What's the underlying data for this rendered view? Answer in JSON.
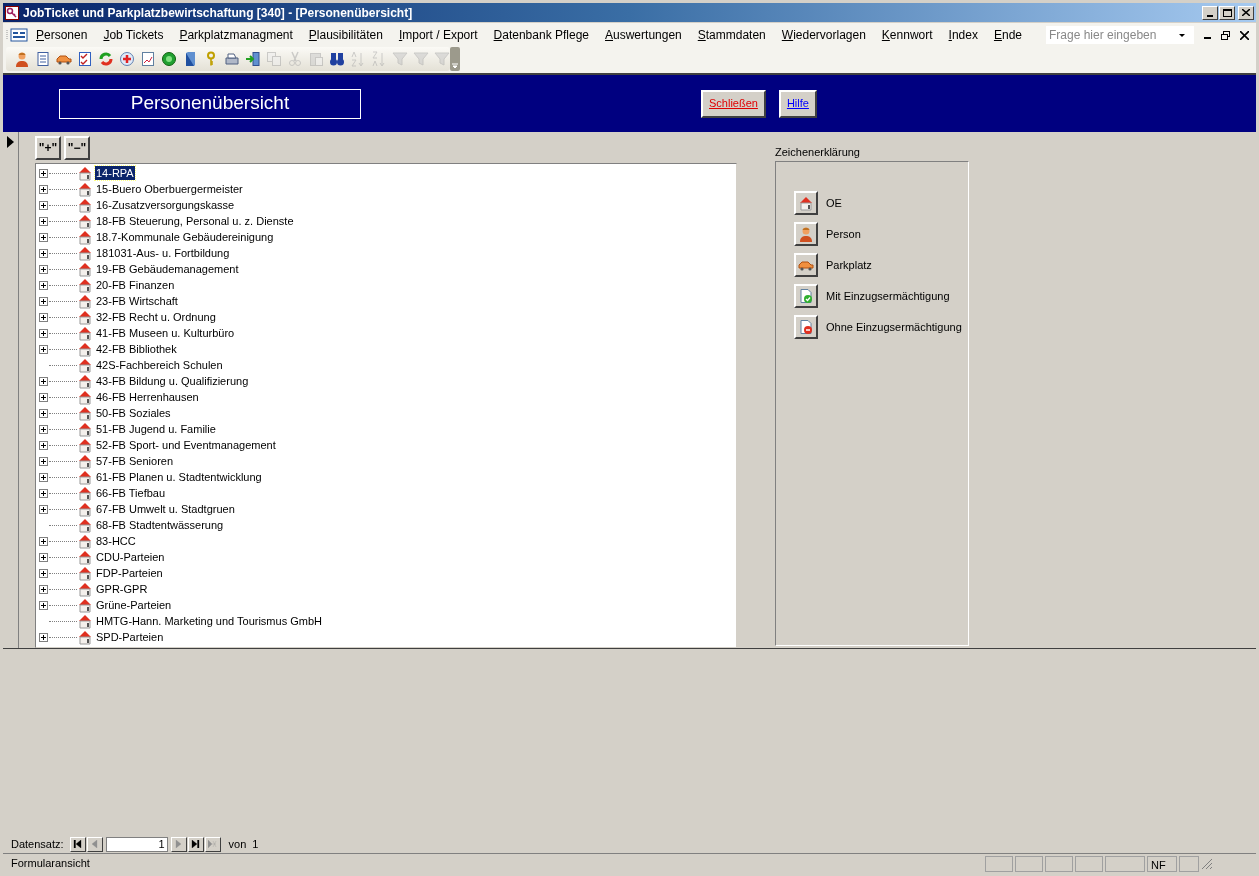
{
  "window": {
    "title": "JobTicket und Parkplatzbewirtschaftung [340] - [Personenübersicht]"
  },
  "menu": [
    "Personen",
    "Job Tickets",
    "Parkplatzmanagment",
    "Plausibilitäten",
    "Import / Export",
    "Datenbank Pflege",
    "Auswertungen",
    "Stammdaten",
    "Wiedervorlagen",
    "Kennwort",
    "Index",
    "Ende"
  ],
  "help_box": {
    "placeholder": "Frage hier eingeben"
  },
  "toolbar": [
    {
      "kind": "person",
      "disabled": false
    },
    {
      "kind": "form",
      "disabled": false
    },
    {
      "kind": "car",
      "disabled": false
    },
    {
      "kind": "checklist",
      "disabled": false
    },
    {
      "kind": "recycle",
      "disabled": false
    },
    {
      "kind": "plus",
      "disabled": false
    },
    {
      "kind": "chart",
      "disabled": false
    },
    {
      "kind": "globe",
      "disabled": false
    },
    {
      "kind": "book",
      "disabled": false
    },
    {
      "kind": "key",
      "disabled": false
    },
    {
      "kind": "printer",
      "disabled": false
    },
    {
      "kind": "exit",
      "disabled": false
    },
    {
      "kind": "copy",
      "disabled": true
    },
    {
      "kind": "cut",
      "disabled": true
    },
    {
      "kind": "paste",
      "disabled": true
    },
    {
      "kind": "binoculars",
      "disabled": false
    },
    {
      "kind": "sortasc",
      "disabled": true
    },
    {
      "kind": "sortdesc",
      "disabled": true
    },
    {
      "kind": "filter",
      "disabled": true
    },
    {
      "kind": "filter",
      "disabled": true
    },
    {
      "kind": "filter",
      "disabled": true
    }
  ],
  "form": {
    "title": "Personenübersicht",
    "buttons": [
      {
        "label": "Schließen",
        "kind": "close"
      },
      {
        "label": "Hilfe",
        "kind": "help"
      }
    ]
  },
  "tree_buttons": [
    "\"+\"",
    "\"−\""
  ],
  "tree": [
    {
      "label": "14-RPA",
      "expandable": true,
      "selected": true
    },
    {
      "label": "15-Buero Oberbuergermeister",
      "expandable": true,
      "selected": false
    },
    {
      "label": "16-Zusatzversorgungskasse",
      "expandable": true,
      "selected": false
    },
    {
      "label": "18-FB Steuerung, Personal u. z. Dienste",
      "expandable": true,
      "selected": false
    },
    {
      "label": "18.7-Kommunale Gebäudereinigung",
      "expandable": true,
      "selected": false
    },
    {
      "label": "181031-Aus- u. Fortbildung",
      "expandable": true,
      "selected": false
    },
    {
      "label": "19-FB Gebäudemanagement",
      "expandable": true,
      "selected": false
    },
    {
      "label": "20-FB Finanzen",
      "expandable": true,
      "selected": false
    },
    {
      "label": "23-FB Wirtschaft",
      "expandable": true,
      "selected": false
    },
    {
      "label": "32-FB Recht u. Ordnung",
      "expandable": true,
      "selected": false
    },
    {
      "label": "41-FB Museen u. Kulturbüro",
      "expandable": true,
      "selected": false
    },
    {
      "label": "42-FB Bibliothek",
      "expandable": true,
      "selected": false
    },
    {
      "label": "42S-Fachbereich Schulen",
      "expandable": false,
      "selected": false
    },
    {
      "label": "43-FB Bildung u. Qualifizierung",
      "expandable": true,
      "selected": false
    },
    {
      "label": "46-FB Herrenhausen",
      "expandable": true,
      "selected": false
    },
    {
      "label": "50-FB Soziales",
      "expandable": true,
      "selected": false
    },
    {
      "label": "51-FB Jugend u. Familie",
      "expandable": true,
      "selected": false
    },
    {
      "label": "52-FB Sport- und Eventmanagement",
      "expandable": true,
      "selected": false
    },
    {
      "label": "57-FB Senioren",
      "expandable": true,
      "selected": false
    },
    {
      "label": "61-FB Planen u. Stadtentwicklung",
      "expandable": true,
      "selected": false
    },
    {
      "label": "66-FB Tiefbau",
      "expandable": true,
      "selected": false
    },
    {
      "label": "67-FB Umwelt u. Stadtgruen",
      "expandable": true,
      "selected": false
    },
    {
      "label": "68-FB Stadtentwässerung",
      "expandable": false,
      "selected": false
    },
    {
      "label": "83-HCC",
      "expandable": true,
      "selected": false
    },
    {
      "label": "CDU-Parteien",
      "expandable": true,
      "selected": false
    },
    {
      "label": "FDP-Parteien",
      "expandable": true,
      "selected": false
    },
    {
      "label": "GPR-GPR",
      "expandable": true,
      "selected": false
    },
    {
      "label": "Grüne-Parteien",
      "expandable": true,
      "selected": false
    },
    {
      "label": "HMTG-Hann. Marketing und Tourismus GmbH",
      "expandable": false,
      "selected": false
    },
    {
      "label": "SPD-Parteien",
      "expandable": true,
      "selected": false
    }
  ],
  "legend": {
    "title": "Zeichenerklärung",
    "items": [
      {
        "kind": "house",
        "label": "OE"
      },
      {
        "kind": "person",
        "label": "Person"
      },
      {
        "kind": "car",
        "label": "Parkplatz"
      },
      {
        "kind": "doc-ok",
        "label": "Mit Einzugsermächtigung"
      },
      {
        "kind": "doc-no",
        "label": "Ohne Einzugsermächtigung"
      }
    ]
  },
  "navigation": {
    "label": "Datensatz:",
    "record": "1",
    "of": "von",
    "total": "1"
  },
  "status_bar": {
    "text": "Formularansicht",
    "indicator": "NF"
  }
}
